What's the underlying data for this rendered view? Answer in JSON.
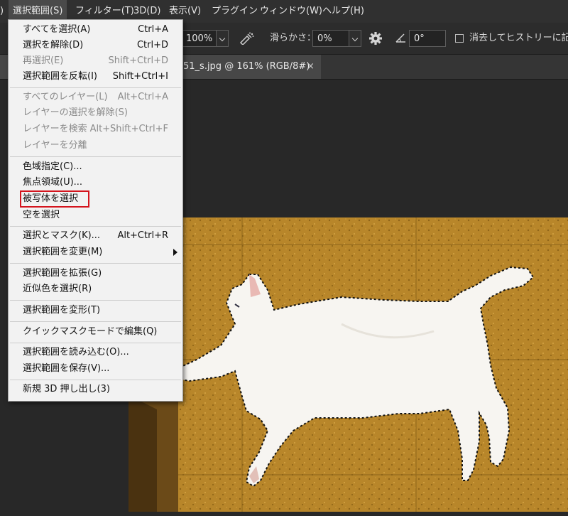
{
  "menubar": {
    "items": [
      {
        "label": ")"
      },
      {
        "label": "選択範囲(S)"
      },
      {
        "label": "フィルター(T)"
      },
      {
        "label": "3D(D)"
      },
      {
        "label": "表示(V)"
      },
      {
        "label": "プラグイン"
      },
      {
        "label": "ウィンドウ(W)"
      },
      {
        "label": "ヘルプ(H)"
      }
    ]
  },
  "options": {
    "zoom_value": "100%",
    "smooth_label": "滑らかさ：",
    "smooth_value": "0%",
    "angle_value": "0°",
    "erase_history_label": "消去してヒストリーに記録"
  },
  "tab": {
    "title": "51_s.jpg @ 161% (RGB/8#)",
    "close": "×"
  },
  "menu": {
    "items": [
      {
        "label": "すべてを選択(A)",
        "shortcut": "Ctrl+A",
        "disabled": false
      },
      {
        "label": "選択を解除(D)",
        "shortcut": "Ctrl+D",
        "disabled": false
      },
      {
        "label": "再選択(E)",
        "shortcut": "Shift+Ctrl+D",
        "disabled": true
      },
      {
        "label": "選択範囲を反転(I)",
        "shortcut": "Shift+Ctrl+I",
        "disabled": false
      },
      {
        "label": "すべてのレイヤー(L)",
        "shortcut": "Alt+Ctrl+A",
        "disabled": true
      },
      {
        "label": "レイヤーの選択を解除(S)",
        "shortcut": "",
        "disabled": true
      },
      {
        "label": "レイヤーを検索",
        "shortcut": "Alt+Shift+Ctrl+F",
        "disabled": true
      },
      {
        "label": "レイヤーを分離",
        "shortcut": "",
        "disabled": true
      },
      {
        "label": "色域指定(C)...",
        "shortcut": "",
        "disabled": false
      },
      {
        "label": "焦点領域(U)...",
        "shortcut": "",
        "disabled": false
      },
      {
        "label": "被写体を選択",
        "shortcut": "",
        "disabled": false
      },
      {
        "label": "空を選択",
        "shortcut": "",
        "disabled": false
      },
      {
        "label": "選択とマスク(K)...",
        "shortcut": "Alt+Ctrl+R",
        "disabled": false
      },
      {
        "label": "選択範囲を変更(M)",
        "shortcut": "",
        "disabled": false
      },
      {
        "label": "選択範囲を拡張(G)",
        "shortcut": "",
        "disabled": false
      },
      {
        "label": "近似色を選択(R)",
        "shortcut": "",
        "disabled": false
      },
      {
        "label": "選択範囲を変形(T)",
        "shortcut": "",
        "disabled": false
      },
      {
        "label": "クイックマスクモードで編集(Q)",
        "shortcut": "",
        "disabled": false
      },
      {
        "label": "選択範囲を読み込む(O)...",
        "shortcut": "",
        "disabled": false
      },
      {
        "label": "選択範囲を保存(V)...",
        "shortcut": "",
        "disabled": false
      },
      {
        "label": "新規 3D 押し出し(3)",
        "shortcut": "",
        "disabled": false
      }
    ]
  },
  "colors": {
    "highlight_box": "#d4141d",
    "floor": "#b8862a",
    "cat": "#f7f5f1"
  }
}
